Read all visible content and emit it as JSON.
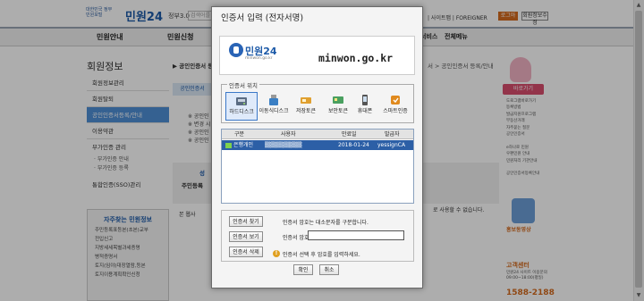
{
  "site": {
    "logo_emblem": "대한민국 정부민원포털",
    "logo_name": "민원24",
    "logo_version": "정부3.0",
    "search_placeholder": "검색어를",
    "top_links": "| 사이트맵 | FOREIGNER",
    "login_label": "로그아웃",
    "join_label": "회원정보수정",
    "gnb": [
      "민원안내",
      "민원신청"
    ],
    "gnb_right": "서비스",
    "gnb_all": "전체메뉴",
    "lnb_title": "회원정보",
    "lnb_items": [
      "회원정보관리",
      "회원탈퇴",
      "공인인증서등록/안내",
      "이용약관",
      "부가인증 관리"
    ],
    "lnb_active_index": 2,
    "lnb_subitems": [
      "· 부가인증 안내",
      "· 부가인증 등록"
    ],
    "lnb_extra": "통합인증(SSO)관리",
    "help_title": "자주찾는 민원정보",
    "help_items": [
      "주민등록표등본(초본)교부",
      "전입신고",
      "지방세세목별과세증명",
      "병적증명서",
      "토지(임야)대장열람,등본",
      "토지이용계획확인신청"
    ],
    "crumb": "▶ 공인인증서 등",
    "crumb_right": "서 > 공인인증서 등록/안내",
    "tab_label": "공인인증서",
    "content_lines": [
      "※ 공인인",
      "※ 변경 시",
      "※ 공인인",
      "※ 공인인"
    ],
    "panel_title": "성",
    "panel_sub": "주민등록",
    "notice_left": "본 웹사",
    "notice_right": "로 사용할 수 없습니다.",
    "rail_btn": "바로가기",
    "rail_links": [
      "도로그램바로가기",
      "등록방법",
      "발급지원프로그램",
      "부동산거래",
      "자주묻는 질문",
      "공인인증서",
      "",
      "e하나로 민원",
      "우편민원 안내",
      "민원처리 기관안내",
      "",
      "공인인증서등록안내"
    ],
    "rail_video": "홍보동영상",
    "call_title": "고객센터",
    "call_sub": [
      "민원24 사이트 이용문의",
      "09:00~18:00(평일)"
    ],
    "call_number": "1588-2188"
  },
  "dialog": {
    "title": "인증서 입력 (전자서명)",
    "banner_logo": "민원24",
    "banner_logo_sub": "minwon.go.kr",
    "banner_url": "minwon.go.kr",
    "location_label": "인증서 위치",
    "locations": [
      {
        "label": "하드디스크",
        "icon": "hard-disk-icon",
        "color": "#5a6b82"
      },
      {
        "label": "이동식디스크",
        "icon": "usb-drive-icon",
        "color": "#3a7fc4"
      },
      {
        "label": "저장토큰",
        "icon": "security-token-icon",
        "color": "#e0a030"
      },
      {
        "label": "보안토큰",
        "icon": "smartcard-icon",
        "color": "#4aa060"
      },
      {
        "label": "휴대폰",
        "icon": "mobile-phone-icon",
        "color": "#555555"
      },
      {
        "label": "스마트인증",
        "icon": "smart-auth-icon",
        "color": "#e08a1e"
      }
    ],
    "selected_location": 0,
    "table_headers": [
      "구분",
      "사용자",
      "만료일",
      "발급자"
    ],
    "cert_rows": [
      {
        "type": "은행개인",
        "user": "▒▒▒▒▒▒▒▒▒",
        "expiry": "2018-01-24",
        "issuer": "yessignCA"
      }
    ],
    "btn_find": "인증서 찾기",
    "btn_view": "인증서 보기",
    "btn_delete": "인증서 삭제",
    "case_note": "인증서 암호는 대소문자를 구분합니다.",
    "password_label": "인증서 암호",
    "password_value": "",
    "hint": "인증서 선택 후 암호를 입력하세요.",
    "ok_label": "확인",
    "cancel_label": "취소"
  }
}
